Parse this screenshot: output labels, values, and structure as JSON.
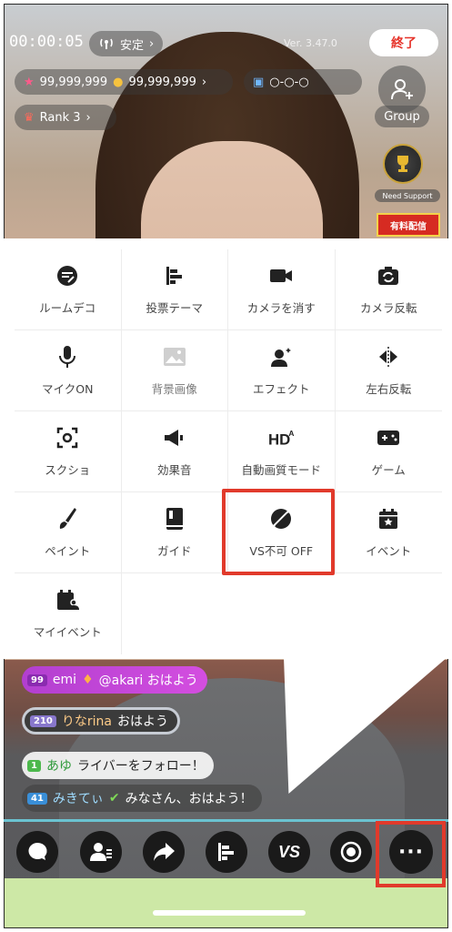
{
  "header": {
    "timer": "00:00:05",
    "connection": "安定",
    "version": "Ver. 3.47.0",
    "end_label": "終了",
    "points": "99,999,999",
    "coins": "99,999,999",
    "rank": "Rank 3",
    "group_label": "Group",
    "need_support": "Need Support",
    "promo": "有料配信"
  },
  "menu": {
    "items": [
      {
        "label": "ルームデコ",
        "icon": "room-deco-icon"
      },
      {
        "label": "投票テーマ",
        "icon": "vote-icon"
      },
      {
        "label": "カメラを消す",
        "icon": "camera-off-icon"
      },
      {
        "label": "カメラ反転",
        "icon": "camera-flip-icon"
      },
      {
        "label": "マイクON",
        "icon": "mic-icon"
      },
      {
        "label": "背景画像",
        "icon": "image-icon"
      },
      {
        "label": "エフェクト",
        "icon": "effect-icon"
      },
      {
        "label": "左右反転",
        "icon": "mirror-icon"
      },
      {
        "label": "スクショ",
        "icon": "screenshot-icon"
      },
      {
        "label": "効果音",
        "icon": "sound-effect-icon"
      },
      {
        "label": "自動画質モード",
        "icon": "hd-icon"
      },
      {
        "label": "ゲーム",
        "icon": "game-icon"
      },
      {
        "label": "ペイント",
        "icon": "paint-icon"
      },
      {
        "label": "ガイド",
        "icon": "guide-icon"
      },
      {
        "label": "VS不可 OFF",
        "icon": "vs-off-icon"
      },
      {
        "label": "イベント",
        "icon": "event-icon"
      },
      {
        "label": "マイイベント",
        "icon": "my-event-icon"
      }
    ]
  },
  "chat": [
    {
      "level": "99",
      "name": "emi",
      "text": "@akari おはよう"
    },
    {
      "level": "210",
      "name": "りなrina",
      "text": "おはよう"
    },
    {
      "level": "1",
      "name": "あゆ",
      "text": "ライバーをフォロー！"
    },
    {
      "level": "41",
      "name": "みきてぃ",
      "text": "みなさん、おはよう！"
    }
  ],
  "toolbar": {
    "vs_label": "VS",
    "more_label": "···"
  }
}
